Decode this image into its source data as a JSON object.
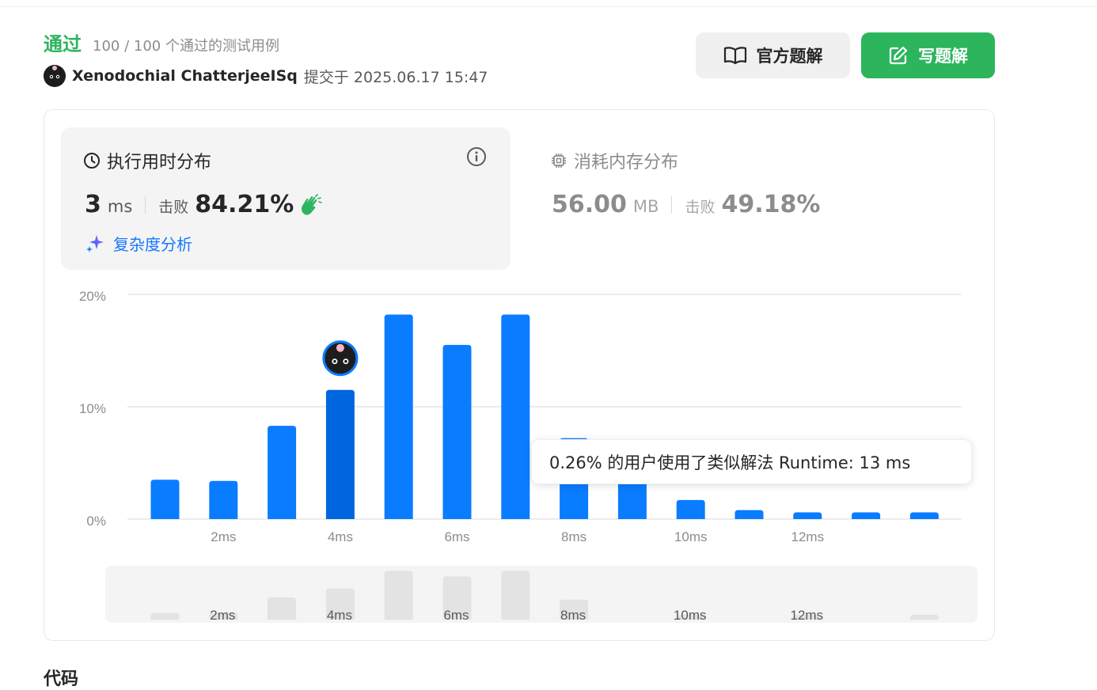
{
  "header": {
    "status_label": "通过",
    "status_count": "100 / 100 个通过的测试用例",
    "author_name": "Xenodochial ChatterjeeISq",
    "submit_text": "提交于 2025.06.17 15:47"
  },
  "buttons": {
    "official_solution": "官方题解",
    "write_solution": "写题解"
  },
  "runtime": {
    "title": "执行用时分布",
    "value": "3",
    "unit": "ms",
    "beat_label": "击败",
    "beat_pct": "84.21%",
    "complexity_link": "复杂度分析"
  },
  "memory": {
    "title": "消耗内存分布",
    "value": "56.00",
    "unit": "MB",
    "beat_label": "击败",
    "beat_pct": "49.18%"
  },
  "tooltip": "0.26% 的用户使用了类似解法 Runtime: 13 ms",
  "code_section_label": "代码",
  "colors": {
    "accent_green": "#2db55d",
    "bar_blue": "#0a7cff",
    "bar_selected": "#0066e0",
    "link_blue": "#1677ff",
    "mini_bar": "#e3e3e3"
  },
  "chart_data": {
    "type": "bar",
    "x_unit": "ms",
    "x": [
      1,
      2,
      3,
      4,
      5,
      6,
      7,
      8,
      9,
      10,
      11,
      12,
      13,
      14
    ],
    "values": [
      3.5,
      3.4,
      8.3,
      11.5,
      18.2,
      15.5,
      18.2,
      7.2,
      4.2,
      1.7,
      0.8,
      0.6,
      0.6,
      0.6
    ],
    "highlight_x": 4,
    "ylim": [
      0,
      20
    ],
    "yticks": [
      "0%",
      "10%",
      "20%"
    ],
    "xticks": [
      "2ms",
      "4ms",
      "6ms",
      "8ms",
      "10ms",
      "12ms"
    ],
    "grid": true,
    "mini_values": [
      0.6,
      0.6,
      2.0,
      2.8,
      4.4,
      3.9,
      4.4,
      1.8,
      0,
      0.4,
      0,
      0.4,
      0,
      0.4
    ]
  }
}
